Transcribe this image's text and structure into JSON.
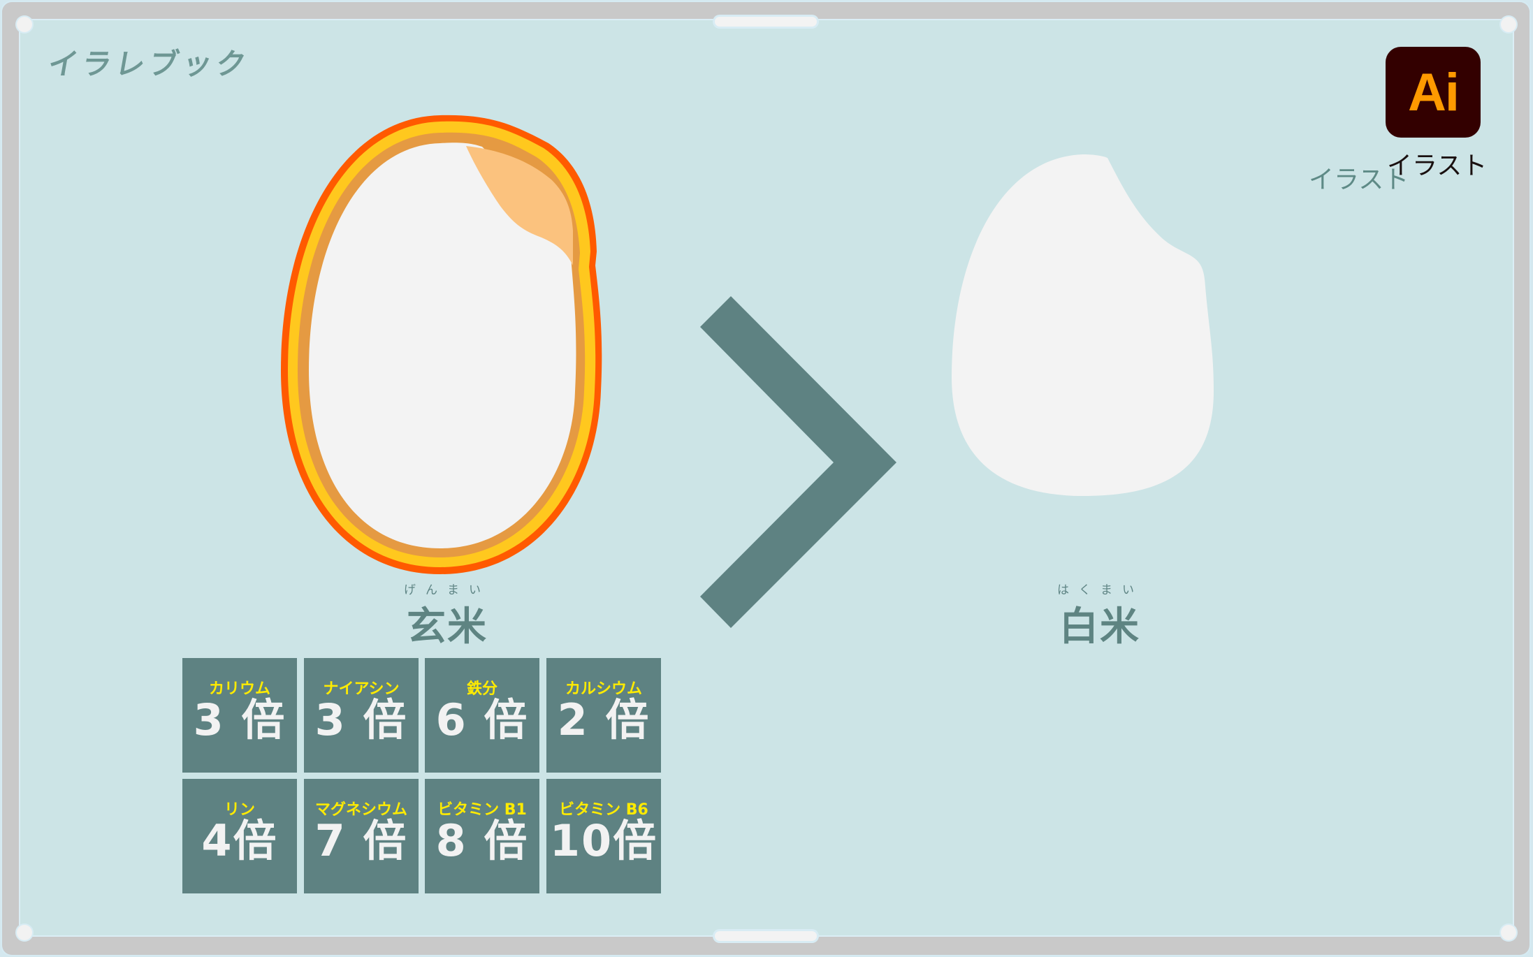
{
  "logo": {
    "text": "イラレブック"
  },
  "app_badge": {
    "icon_text": "Ai",
    "label": "イラスト",
    "ghost_label": "イラスト"
  },
  "colors": {
    "background": "#cce4e6",
    "accent_dark": "#5e8282",
    "highlight_yellow": "#ffeb00",
    "bran_outer": "#ff5a00",
    "bran_middle": "#ffc81e",
    "bran_inner": "#e59a42",
    "germ": "#fbc27e",
    "rice_white": "#f3f3f3"
  },
  "comparison": {
    "left": {
      "label": "玄米",
      "reading": "げんまい"
    },
    "operator": "greater-than",
    "right": {
      "label": "白米",
      "reading": "はくまい"
    }
  },
  "nutrients": [
    {
      "name": "カリウム",
      "multiplier": "3 倍"
    },
    {
      "name": "ナイアシン",
      "multiplier": "3 倍"
    },
    {
      "name": "鉄分",
      "multiplier": "6 倍"
    },
    {
      "name": "カルシウム",
      "multiplier": "2 倍"
    },
    {
      "name": "リン",
      "multiplier": "4倍"
    },
    {
      "name": "マグネシウム",
      "multiplier": "7 倍"
    },
    {
      "name": "ビタミン B1",
      "multiplier": "8 倍"
    },
    {
      "name": "ビタミン B6",
      "multiplier": "10倍"
    }
  ]
}
